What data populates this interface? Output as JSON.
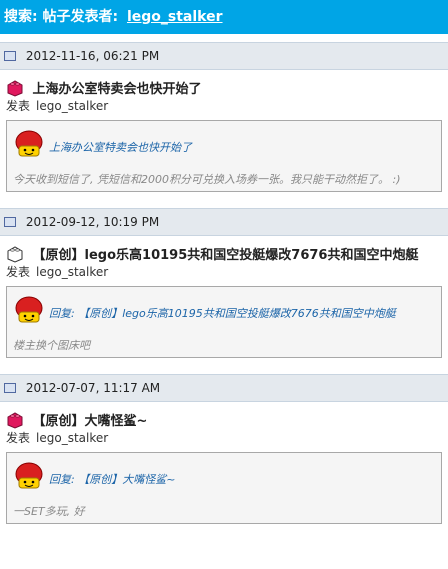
{
  "header": {
    "label": "搜索:",
    "subtitle": "帖子发表者:",
    "username": "lego_stalker"
  },
  "posts": [
    {
      "date": "2012-11-16, 06:21 PM",
      "title": "上海办公室特卖会也快开始了",
      "posted_by_label": "发表",
      "author": "lego_stalker",
      "quote_title": "上海办公室特卖会也快开始了",
      "quote_body": "今天收到短信了, 凭短信和2000积分可兑换入场券一张。我只能干动然拒了。 :)",
      "icon_color": "#e0185e"
    },
    {
      "date": "2012-09-12, 10:19 PM",
      "title": "【原创】lego乐高10195共和国空投艇爆改7676共和国空中炮艇",
      "posted_by_label": "发表",
      "author": "lego_stalker",
      "quote_title": "回复: 【原创】lego乐高10195共和国空投艇爆改7676共和国空中炮艇",
      "quote_body": "楼主换个图床吧",
      "icon_color": "#ffffff"
    },
    {
      "date": "2012-07-07, 11:17 AM",
      "title": "【原创】大嘴怪鲨~",
      "posted_by_label": "发表",
      "author": "lego_stalker",
      "quote_title": "回复: 【原创】大嘴怪鲨~",
      "quote_body": "一SET多玩, 好",
      "icon_color": "#e0185e"
    }
  ]
}
